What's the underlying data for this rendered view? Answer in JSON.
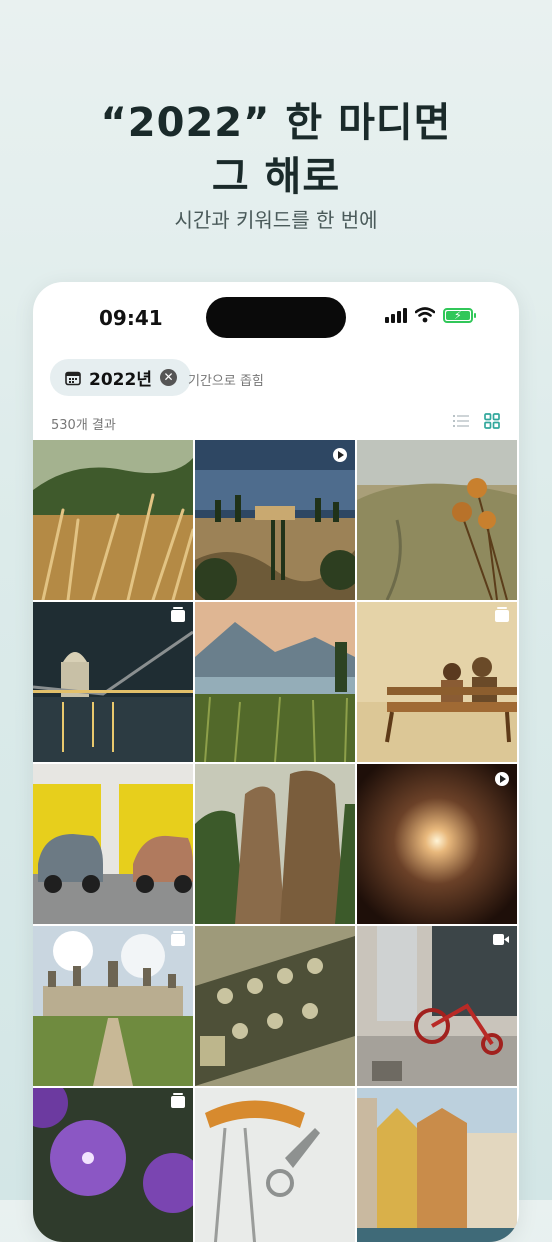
{
  "promo": {
    "headline_line1": "“2022” 한 마디면",
    "headline_line2": "그 해로",
    "subtitle": "시간과 키워드를 한 번에"
  },
  "status_bar": {
    "time": "09:41"
  },
  "filter": {
    "chip_label": "2022년",
    "collapse_text": "기간으로 좁힘"
  },
  "results": {
    "count_label": "530개 결과"
  },
  "colors": {
    "accent": "#31a79c",
    "battery": "#31c759"
  },
  "photos": [
    {
      "subject": "wheat-field",
      "badge": "none"
    },
    {
      "subject": "tuscany-villa",
      "badge": "play"
    },
    {
      "subject": "thistle-valley",
      "badge": "none"
    },
    {
      "subject": "london-night",
      "badge": "stack"
    },
    {
      "subject": "lake-reeds",
      "badge": "none"
    },
    {
      "subject": "couple-bench",
      "badge": "stack"
    },
    {
      "subject": "vintage-cars",
      "badge": "none"
    },
    {
      "subject": "rock-cliffs",
      "badge": "none"
    },
    {
      "subject": "tunnel-light",
      "badge": "play"
    },
    {
      "subject": "chateau",
      "badge": "stack"
    },
    {
      "subject": "guitar-head",
      "badge": "none"
    },
    {
      "subject": "red-tricycle",
      "badge": "video"
    },
    {
      "subject": "purple-flowers",
      "badge": "stack"
    },
    {
      "subject": "scissors-yarn",
      "badge": "none"
    },
    {
      "subject": "canal-houses",
      "badge": "none"
    }
  ]
}
